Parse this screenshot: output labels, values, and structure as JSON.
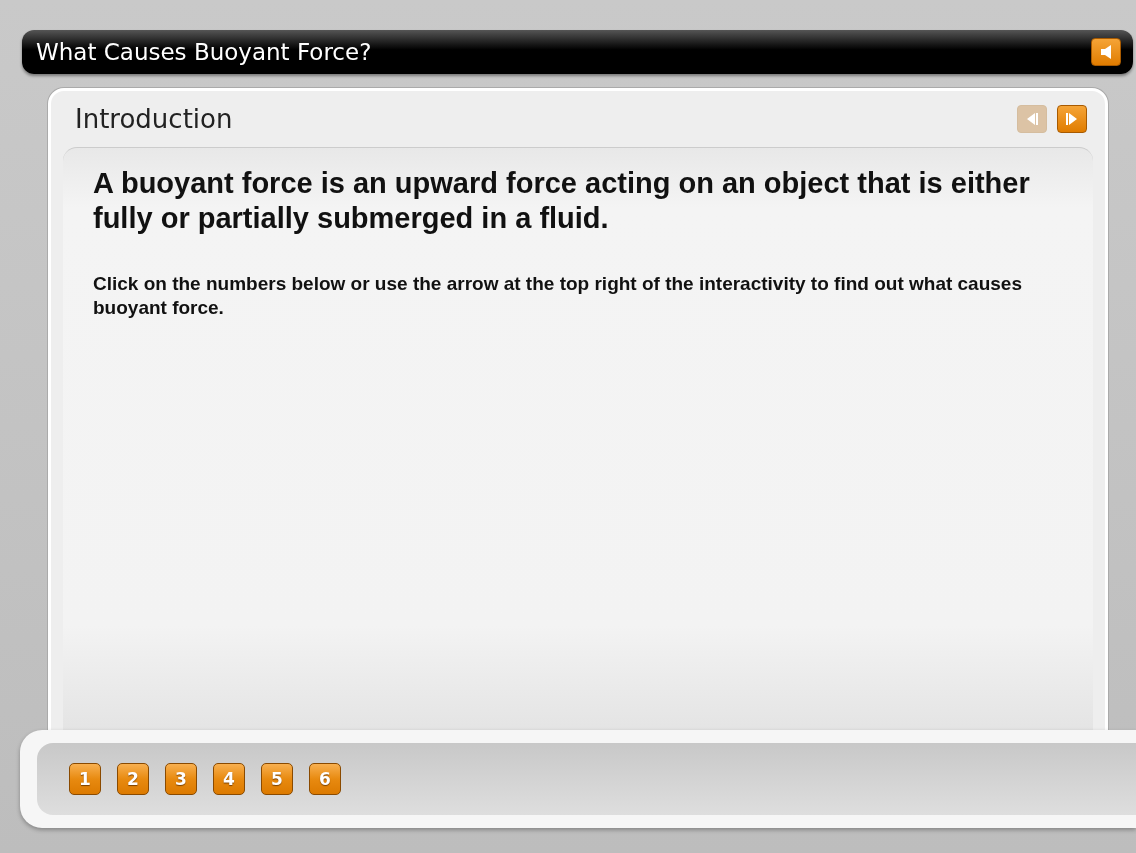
{
  "title_bar": {
    "title": "What Causes Buoyant Force?"
  },
  "panel": {
    "heading": "Introduction",
    "prev_button": {
      "disabled": true
    },
    "next_button": {
      "disabled": false
    }
  },
  "content": {
    "lead": "A buoyant force is an upward force acting on an object that is either fully or partially submerged in a fluid.",
    "instruction": "Click on the numbers below or use the arrow at the top right of the interactivity to find out what causes buoyant force."
  },
  "pages": [
    "1",
    "2",
    "3",
    "4",
    "5",
    "6"
  ]
}
